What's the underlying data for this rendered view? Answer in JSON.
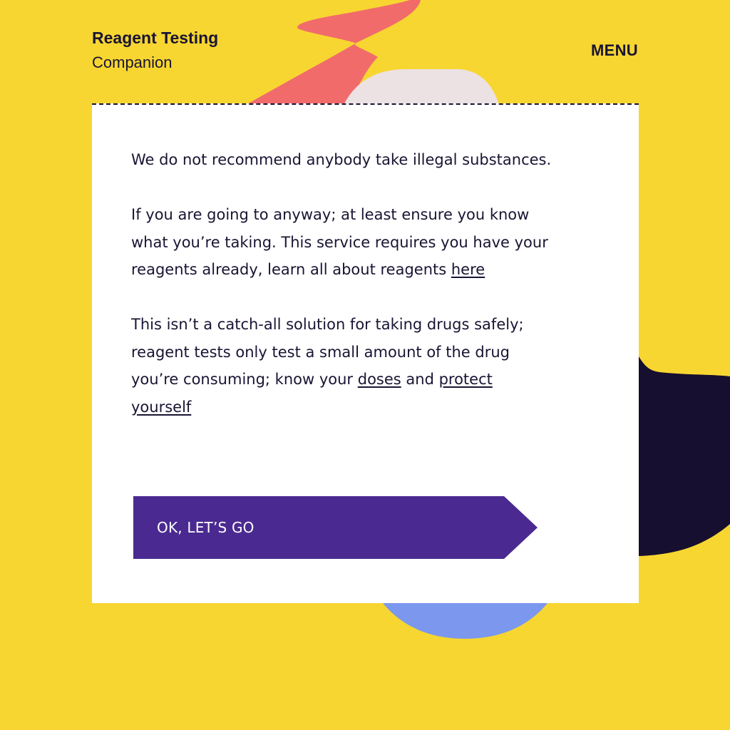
{
  "header": {
    "brand_title": "Reagent Testing",
    "brand_subtitle": "Companion",
    "menu_label": "MENU"
  },
  "disclaimer": {
    "paragraph_1": "We do not recommend anybody take illegal substances.",
    "paragraph_2_text": "If you are going to anyway; at least ensure you know what you’re taking. This service requires you have your reagents already, learn all about reagents ",
    "paragraph_2_link": "here",
    "paragraph_3_text": "This isn’t a catch-all solution for taking drugs safely; reagent tests only test a small amount of the drug you’re consuming; know your ",
    "paragraph_3_link_doses": "doses",
    "paragraph_3_and": " and ",
    "paragraph_3_link_protect": "protect yourself"
  },
  "cta": {
    "label": "OK, LET’S GO"
  },
  "colors": {
    "background": "#f7d631",
    "card": "#ffffff",
    "text": "#1a1433",
    "button": "#4a2a91",
    "shape_coral": "#f26b6b",
    "shape_pink": "#ece1e3",
    "shape_navy": "#170f2f",
    "shape_blue": "#7b97ee"
  }
}
